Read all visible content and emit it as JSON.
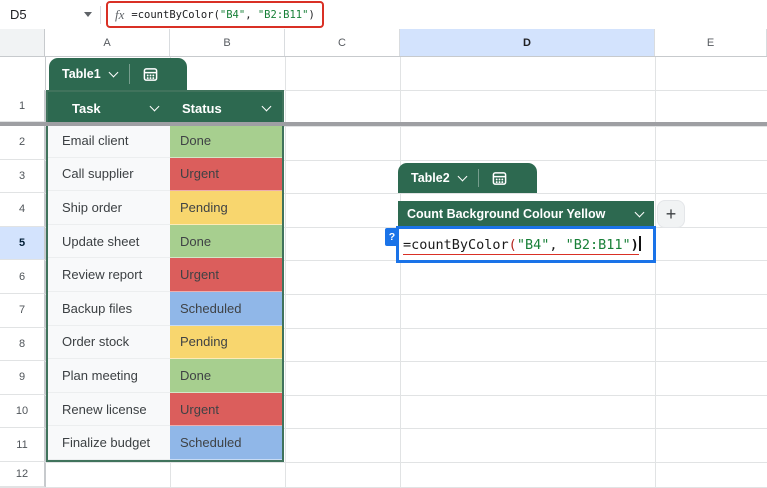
{
  "formula_bar": {
    "cell_reference": "D5",
    "fx_label": "fx",
    "formula": {
      "function_name": "=countByColor",
      "open_paren": "(",
      "arg1": "\"B4\"",
      "separator": ", ",
      "arg2": "\"B2:B11\"",
      "close_paren": ")"
    }
  },
  "grid": {
    "column_headers": [
      "A",
      "B",
      "C",
      "D",
      "E"
    ],
    "selected_column": "D",
    "row_headers": [
      "1",
      "2",
      "3",
      "4",
      "5",
      "6",
      "7",
      "8",
      "9",
      "10",
      "11",
      "12"
    ],
    "selected_row": "5"
  },
  "table1": {
    "chip_label": "Table1",
    "columns": [
      "Task",
      "Status"
    ],
    "rows": [
      {
        "task": "Email client",
        "status": "Done"
      },
      {
        "task": "Call supplier",
        "status": "Urgent"
      },
      {
        "task": "Ship order",
        "status": "Pending"
      },
      {
        "task": "Update sheet",
        "status": "Done"
      },
      {
        "task": "Review report",
        "status": "Urgent"
      },
      {
        "task": "Backup files",
        "status": "Scheduled"
      },
      {
        "task": "Order stock",
        "status": "Pending"
      },
      {
        "task": "Plan meeting",
        "status": "Done"
      },
      {
        "task": "Renew license",
        "status": "Urgent"
      },
      {
        "task": "Finalize budget",
        "status": "Scheduled"
      }
    ]
  },
  "table2": {
    "chip_label": "Table2",
    "column_header": "Count Background Colour Yellow",
    "add_column_button": "+",
    "help_badge": "?",
    "cell_formula": {
      "function_name": "=countByColor",
      "open_paren": "(",
      "arg1": "\"B4\"",
      "separator": ", ",
      "arg2": "\"B2:B11\"",
      "close_paren": ")"
    }
  },
  "icons": {
    "name_box_dropdown": "dropdown-arrow-icon",
    "formula_prefix": "fx-icon",
    "table_chip": "table-grid-icon",
    "header_dropdown": "chevron-down-icon"
  },
  "colors": {
    "status": {
      "Done": "#a7cf8f",
      "Urgent": "#db5e5c",
      "Pending": "#f8d66e",
      "Scheduled": "#90b7e8"
    },
    "table_green": "#2d6950",
    "table_border_green": "#40735c",
    "selection_blue": "#1a73e8",
    "selected_header_bg": "#d3e3fd",
    "annotation_red": "#d93025",
    "formula_string_green": "#188038"
  }
}
